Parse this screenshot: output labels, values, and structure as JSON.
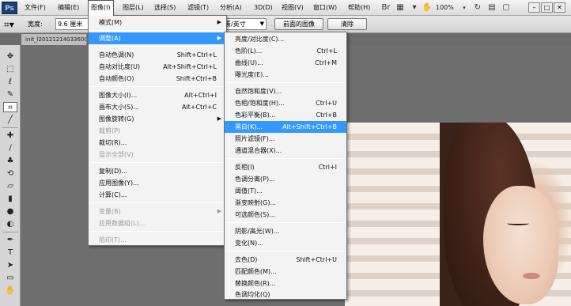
{
  "app": {
    "logo": "Ps"
  },
  "menubar": {
    "items": [
      {
        "label": "文件(F)"
      },
      {
        "label": "编辑(E)"
      },
      {
        "label": "图像(I)"
      },
      {
        "label": "图层(L)"
      },
      {
        "label": "选择(S)"
      },
      {
        "label": "滤镜(T)"
      },
      {
        "label": "分析(A)"
      },
      {
        "label": "3D(D)"
      },
      {
        "label": "视图(V)"
      },
      {
        "label": "窗口(W)"
      },
      {
        "label": "帮助(H)"
      }
    ],
    "zoom": "100%",
    "window_buttons": [
      "–",
      "□",
      "✕"
    ]
  },
  "options": {
    "width_label": "宽度:",
    "width_value": "9.6 厘米",
    "unit_value": "素/英寸",
    "front_image_button": "前面的图像",
    "clear_button": "清除"
  },
  "document": {
    "tab_title": "init_l2012121403360014"
  },
  "image_menu": {
    "items": [
      {
        "label": "模式(M)",
        "shortcut": "",
        "submenu": true
      },
      {
        "label": "调整(A)",
        "shortcut": "",
        "submenu": true,
        "highlighted": true
      },
      {
        "label": "自动色调(N)",
        "shortcut": "Shift+Ctrl+L"
      },
      {
        "label": "自动对比度(U)",
        "shortcut": "Alt+Shift+Ctrl+L"
      },
      {
        "label": "自动颜色(O)",
        "shortcut": "Shift+Ctrl+B"
      },
      {
        "label": "图像大小(I)...",
        "shortcut": "Alt+Ctrl+I"
      },
      {
        "label": "画布大小(S)...",
        "shortcut": "Alt+Ctrl+C"
      },
      {
        "label": "图像旋转(G)",
        "shortcut": "",
        "submenu": true
      },
      {
        "label": "裁剪(P)",
        "shortcut": "",
        "disabled": true
      },
      {
        "label": "裁切(R)...",
        "shortcut": ""
      },
      {
        "label": "显示全部(V)",
        "shortcut": "",
        "disabled": true
      },
      {
        "label": "复制(D)...",
        "shortcut": ""
      },
      {
        "label": "应用图像(Y)...",
        "shortcut": ""
      },
      {
        "label": "计算(C)...",
        "shortcut": ""
      },
      {
        "label": "变量(B)",
        "shortcut": "",
        "submenu": true,
        "disabled": true
      },
      {
        "label": "应用数据组(L)...",
        "shortcut": "",
        "disabled": true
      },
      {
        "label": "陷印(T)...",
        "shortcut": "",
        "disabled": true
      }
    ]
  },
  "adjust_menu": {
    "items": [
      {
        "label": "亮度/对比度(C)...",
        "shortcut": ""
      },
      {
        "label": "色阶(L)...",
        "shortcut": "Ctrl+L"
      },
      {
        "label": "曲线(U)...",
        "shortcut": "Ctrl+M"
      },
      {
        "label": "曝光度(E)...",
        "shortcut": ""
      },
      {
        "label": "自然饱和度(V)...",
        "shortcut": ""
      },
      {
        "label": "色相/饱和度(H)...",
        "shortcut": "Ctrl+U"
      },
      {
        "label": "色彩平衡(B)...",
        "shortcut": "Ctrl+B"
      },
      {
        "label": "黑白(K)...",
        "shortcut": "Alt+Shift+Ctrl+B",
        "highlighted": true
      },
      {
        "label": "照片滤镜(F)...",
        "shortcut": ""
      },
      {
        "label": "通道混合器(X)...",
        "shortcut": ""
      },
      {
        "label": "反相(I)",
        "shortcut": "Ctrl+I"
      },
      {
        "label": "色调分离(P)...",
        "shortcut": ""
      },
      {
        "label": "阈值(T)...",
        "shortcut": ""
      },
      {
        "label": "渐变映射(G)...",
        "shortcut": ""
      },
      {
        "label": "可选颜色(S)...",
        "shortcut": ""
      },
      {
        "label": "阴影/高光(W)...",
        "shortcut": ""
      },
      {
        "label": "变化(N)...",
        "shortcut": ""
      },
      {
        "label": "去色(D)",
        "shortcut": "Shift+Ctrl+U"
      },
      {
        "label": "匹配颜色(M)...",
        "shortcut": ""
      },
      {
        "label": "替换颜色(R)...",
        "shortcut": ""
      },
      {
        "label": "色调均化(Q)",
        "shortcut": ""
      }
    ]
  },
  "tools": [
    "move-tool",
    "marquee-tool",
    "lasso-tool",
    "quick-select-tool",
    "crop-tool",
    "eyedropper-tool",
    "healing-brush-tool",
    "brush-tool",
    "clone-stamp-tool",
    "history-brush-tool",
    "eraser-tool",
    "gradient-tool",
    "blur-tool",
    "dodge-tool",
    "pen-tool",
    "type-tool",
    "path-select-tool",
    "shape-tool",
    "hand-tool"
  ]
}
